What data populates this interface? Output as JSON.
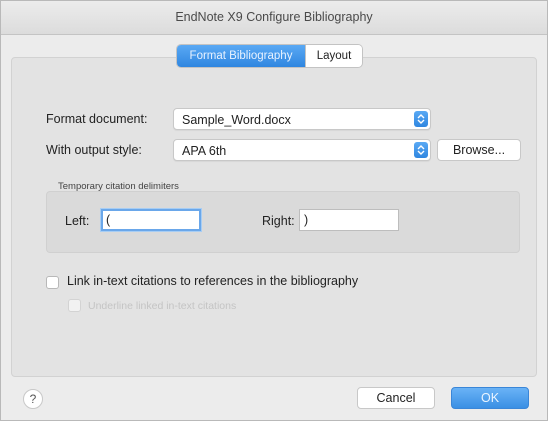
{
  "window": {
    "title": "EndNote X9 Configure Bibliography"
  },
  "tabs": [
    {
      "label": "Format Bibliography",
      "active": true
    },
    {
      "label": "Layout",
      "active": false
    }
  ],
  "form": {
    "format_document_label": "Format document:",
    "format_document_value": "Sample_Word.docx",
    "output_style_label": "With output style:",
    "output_style_value": "APA 6th",
    "browse_label": "Browse..."
  },
  "delimiters": {
    "group_title": "Temporary citation delimiters",
    "left_label": "Left:",
    "left_value": "(",
    "right_label": "Right:",
    "right_value": ")"
  },
  "options": {
    "link_label": "Link in-text citations to references in the bibliography",
    "link_checked": false,
    "underline_label": "Underline linked in-text citations",
    "underline_checked": false,
    "underline_enabled": false
  },
  "footer": {
    "help_label": "?",
    "cancel_label": "Cancel",
    "ok_label": "OK"
  },
  "colors": {
    "accent": "#3a8fe4",
    "window_bg": "#ececec"
  }
}
